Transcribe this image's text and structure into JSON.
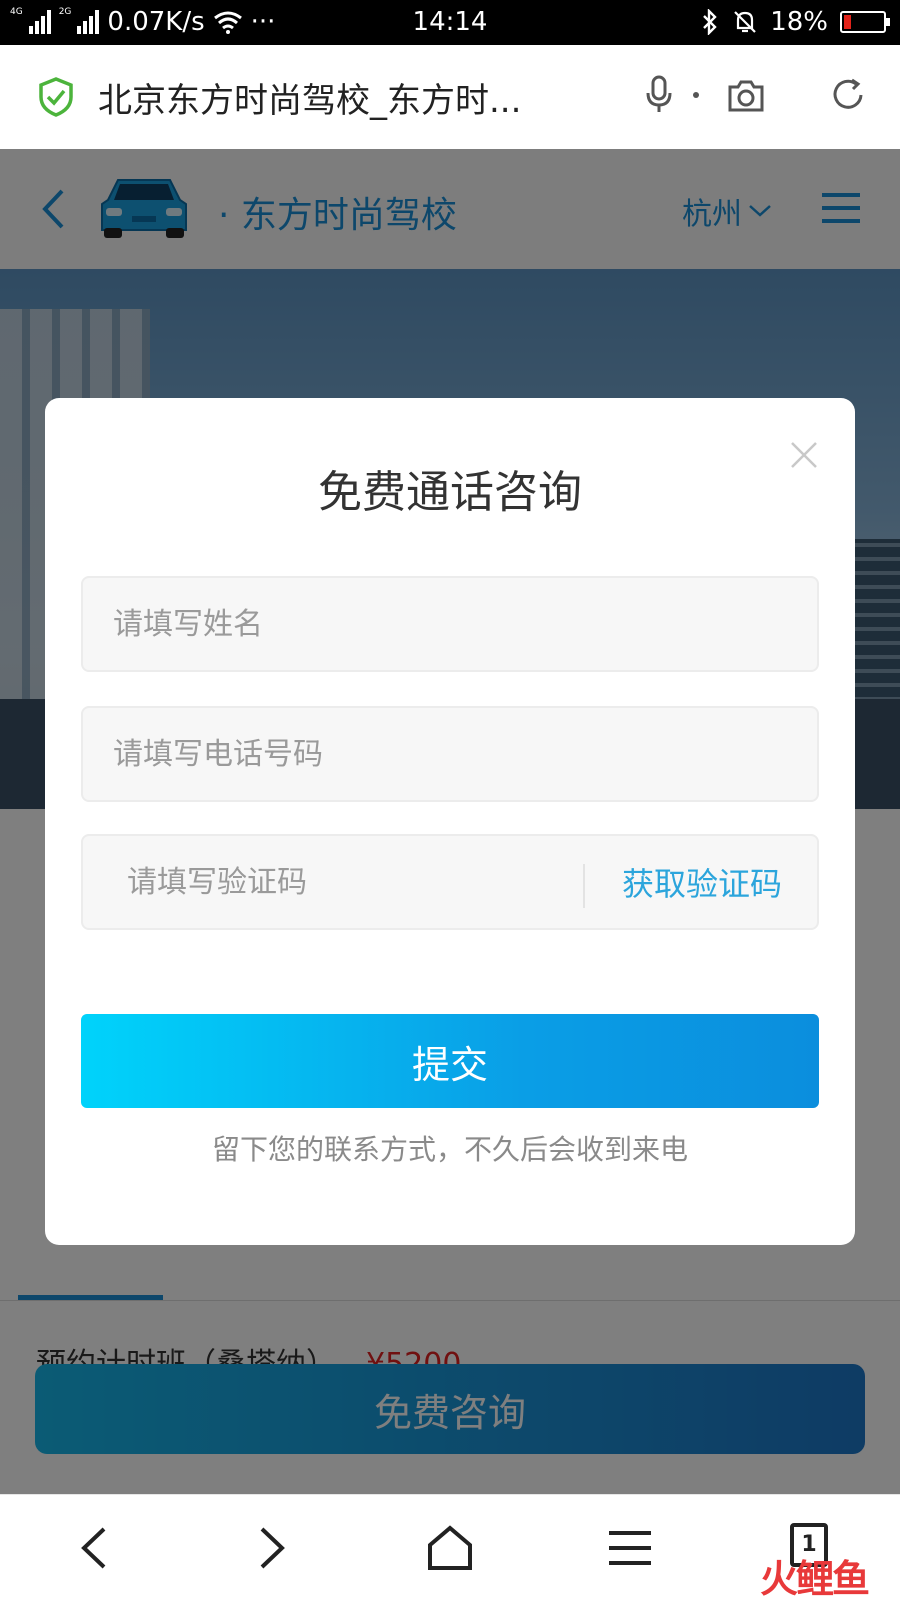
{
  "status_bar": {
    "network_4g": "4G",
    "network_2g": "2G",
    "speed": "0.07K/s",
    "dots": "···",
    "time": "14:14",
    "battery": "18%",
    "battery_level": 0.18,
    "battery_color": "#e2231a"
  },
  "browser": {
    "page_title": "北京东方时尚驾校_东方时...",
    "icons": [
      "shield-icon",
      "microphone-icon",
      "camera-icon",
      "refresh-icon"
    ]
  },
  "site": {
    "brand": "东方时尚驾校",
    "city": "杭州",
    "accent_color": "#1a8fd6",
    "course_name": "预约计时班（桑塔纳）",
    "course_price": "¥5200",
    "free_consult_button": "免费咨询"
  },
  "modal": {
    "title": "免费通话咨询",
    "name_placeholder": "请填写姓名",
    "phone_placeholder": "请填写电话号码",
    "code_placeholder": "请填写验证码",
    "get_code_label": "获取验证码",
    "submit_label": "提交",
    "tip": "留下您的联系方式，不久后会收到来电"
  },
  "bottom_nav": {
    "tab_count": "1",
    "icons": [
      "back-icon",
      "forward-icon",
      "home-icon",
      "menu-icon",
      "tabs-icon"
    ]
  },
  "watermark": "火鲤鱼"
}
